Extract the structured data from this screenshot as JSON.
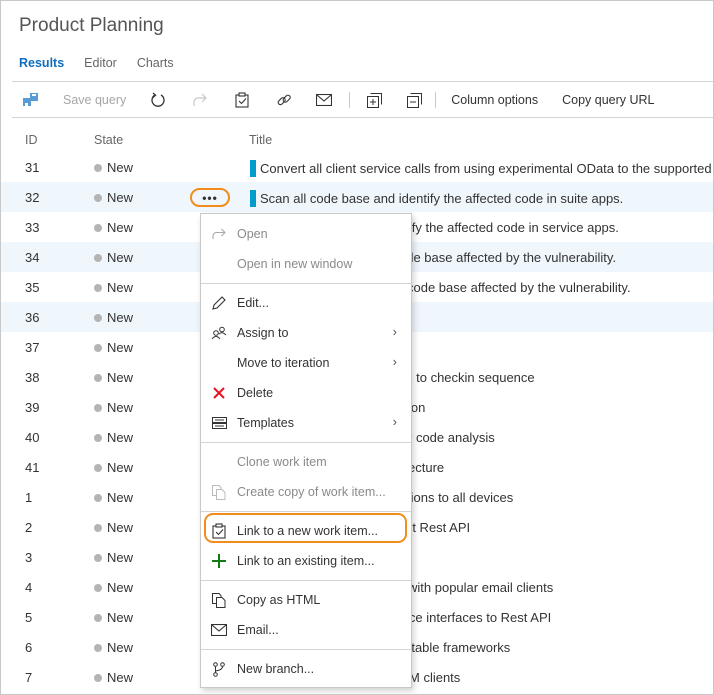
{
  "header": {
    "title": "Product Planning"
  },
  "tabs": [
    {
      "label": "Results",
      "active": true
    },
    {
      "label": "Editor",
      "active": false
    },
    {
      "label": "Charts",
      "active": false
    }
  ],
  "toolbar": {
    "save_query_label": "Save query",
    "column_options_label": "Column options",
    "copy_query_url_label": "Copy query URL",
    "icons": [
      "save-icon",
      "refresh-icon",
      "redo-icon",
      "clipboard-check-icon",
      "link-icon",
      "mail-icon",
      "expand-all-icon",
      "collapse-all-icon"
    ]
  },
  "columns": {
    "id": "ID",
    "state": "State",
    "title": "Title"
  },
  "rows": [
    {
      "id": "31",
      "state": "New",
      "title": "Convert all client service calls from using experimental OData to the supported",
      "bar": true
    },
    {
      "id": "32",
      "state": "New",
      "title": "Scan all code base and identify the affected code in suite apps.",
      "bar": true,
      "selected": true
    },
    {
      "id": "33",
      "state": "New",
      "title": "ntify the affected code in service apps."
    },
    {
      "id": "34",
      "state": "New",
      "title": "ode base affected by the vulnerability."
    },
    {
      "id": "35",
      "state": "New",
      "title": "code base affected by the vulnerability."
    },
    {
      "id": "36",
      "state": "New",
      "title": ""
    },
    {
      "id": "37",
      "state": "New",
      "title": ""
    },
    {
      "id": "38",
      "state": "New",
      "title": "x to checkin sequence"
    },
    {
      "id": "39",
      "state": "New",
      "title": "ion"
    },
    {
      "id": "40",
      "state": "New",
      "title": "r code analysis"
    },
    {
      "id": "41",
      "state": "New",
      "title": "ecture"
    },
    {
      "id": "1",
      "state": "New",
      "title": "tions to all devices"
    },
    {
      "id": "2",
      "state": "New",
      "title": "rt Rest API"
    },
    {
      "id": "3",
      "state": "New",
      "title": ""
    },
    {
      "id": "4",
      "state": "New",
      "title": "with popular email clients"
    },
    {
      "id": "5",
      "state": "New",
      "title": "ice interfaces to Rest API"
    },
    {
      "id": "6",
      "state": "New",
      "title": "rtable frameworks"
    },
    {
      "id": "7",
      "state": "New",
      "title": "M clients"
    }
  ],
  "more_button": {
    "label": "•••"
  },
  "context_menu": {
    "open": "Open",
    "open_new_window": "Open in new window",
    "edit": "Edit...",
    "assign_to": "Assign to",
    "move_to_iteration": "Move to iteration",
    "delete": "Delete",
    "templates": "Templates",
    "clone": "Clone work item",
    "create_copy": "Create copy of work item...",
    "link_new": "Link to a new work item...",
    "link_existing": "Link to an existing item...",
    "copy_html": "Copy as HTML",
    "email": "Email...",
    "new_branch": "New branch...",
    "chevron": "›"
  },
  "colors": {
    "accent": "#106ebe",
    "highlight": "#f28c1c",
    "title_bar": "#009ccc",
    "delete": "#e81123",
    "add": "#107c10"
  }
}
